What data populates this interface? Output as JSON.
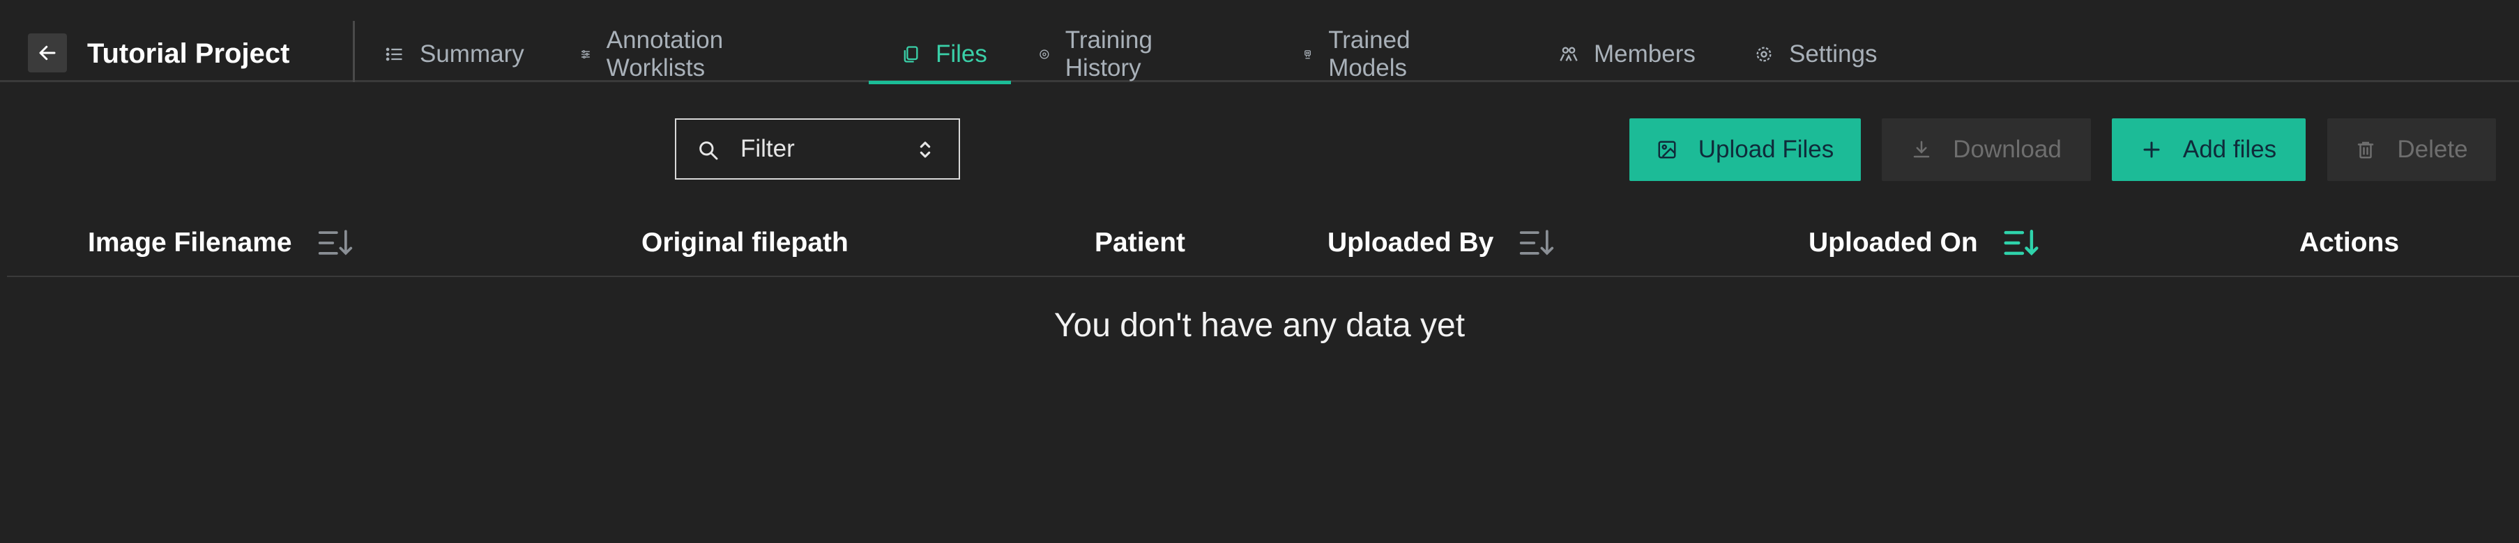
{
  "header": {
    "back_icon": "arrow-left-icon",
    "project_title": "Tutorial Project",
    "tabs": [
      {
        "label": "Summary",
        "icon": "list-icon",
        "active": false
      },
      {
        "label": "Annotation Worklists",
        "icon": "sliders-icon",
        "active": false
      },
      {
        "label": "Files",
        "icon": "files-icon",
        "active": true
      },
      {
        "label": "Training History",
        "icon": "history-icon",
        "active": false
      },
      {
        "label": "Trained Models",
        "icon": "robot-icon",
        "active": false
      },
      {
        "label": "Members",
        "icon": "members-icon",
        "active": false
      },
      {
        "label": "Settings",
        "icon": "gear-icon",
        "active": false
      }
    ]
  },
  "toolbar": {
    "filter_label": "Filter",
    "upload_label": "Upload Files",
    "download_label": "Download",
    "add_label": "Add files",
    "delete_label": "Delete"
  },
  "table": {
    "columns": [
      "Image Filename",
      "Original filepath",
      "Patient",
      "Uploaded By",
      "Uploaded On",
      "Actions"
    ],
    "active_sort_column": "Uploaded On",
    "empty_message": "You don't have any data yet"
  },
  "colors": {
    "accent": "#1cbb97",
    "background": "#222222",
    "muted_text": "#a9b1b9"
  }
}
